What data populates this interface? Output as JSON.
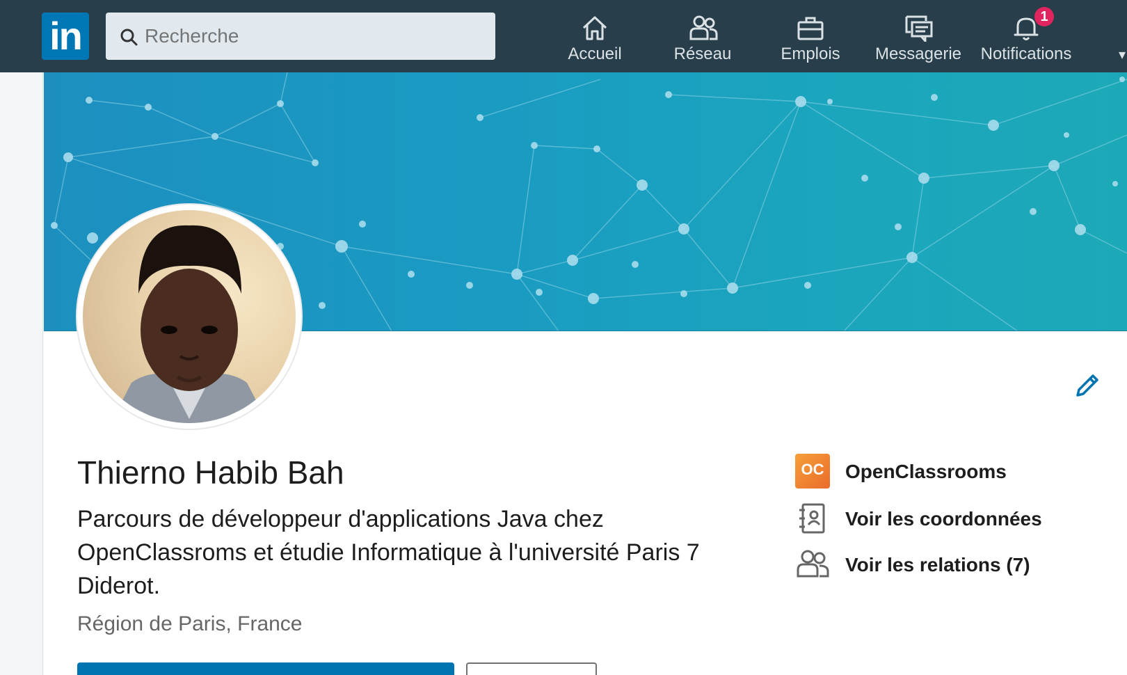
{
  "topbar": {
    "logo_text": "in",
    "search_placeholder": "Recherche",
    "nav": [
      {
        "label": "Accueil",
        "icon": "home-icon"
      },
      {
        "label": "Réseau",
        "icon": "network-icon"
      },
      {
        "label": "Emplois",
        "icon": "briefcase-icon"
      },
      {
        "label": "Messagerie",
        "icon": "messaging-icon"
      },
      {
        "label": "Notifications",
        "icon": "bell-icon",
        "badge": "1"
      }
    ]
  },
  "profile": {
    "name": "Thierno Habib Bah",
    "headline": "Parcours de développeur d'applications Java chez OpenClassroms et étudie Informatique à l'université Paris 7 Diderot.",
    "location": "Région de Paris, France",
    "company_logo_text": "OC",
    "company": "OpenClassrooms",
    "contact_link": "Voir les coordonnées",
    "connections_link": "Voir les relations (7)"
  },
  "colors": {
    "topbar_bg": "#283e4a",
    "brand_blue": "#0077b5",
    "banner": "#1a9bc2",
    "badge": "#e0245e"
  }
}
